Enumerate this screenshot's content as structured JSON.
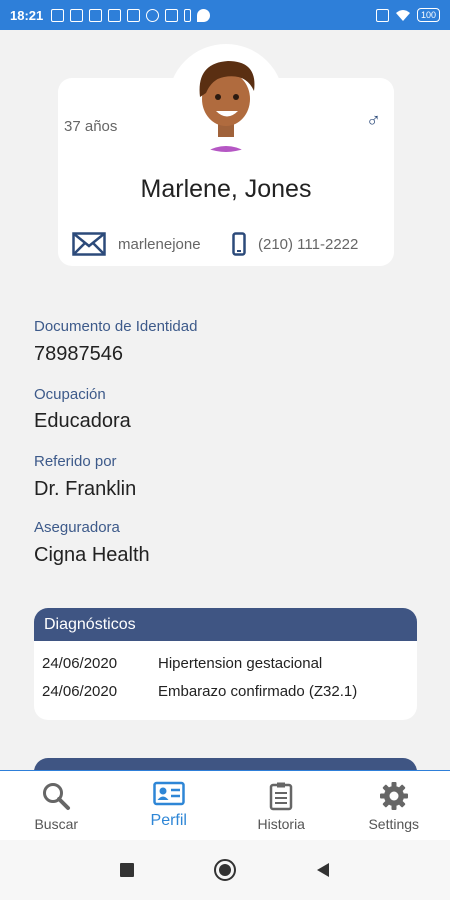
{
  "status_bar": {
    "time": "18:21",
    "battery": "100",
    "icons": [
      "upload-icon",
      "telegram-icon",
      "app-icon",
      "youtube-icon",
      "photo-icon",
      "check-icon",
      "instagram-icon",
      "pin-icon",
      "twitter-icon"
    ]
  },
  "profile": {
    "age": "37 años",
    "gender_symbol": "♂",
    "name": "Marlene, Jones",
    "email": "marlenejone",
    "phone": "(210) 111-2222"
  },
  "fields": [
    {
      "label": "Documento de Identidad",
      "value": "78987546"
    },
    {
      "label": "Ocupación",
      "value": "Educadora"
    },
    {
      "label": "Referido por",
      "value": "Dr. Franklin"
    },
    {
      "label": "Aseguradora",
      "value": "Cigna Health"
    }
  ],
  "diagnostics": {
    "title": "Diagnósticos",
    "rows": [
      {
        "date": "24/06/2020",
        "text": "Hipertension gestacional"
      },
      {
        "date": "24/06/2020",
        "text": "Embarazo confirmado (Z32.1)"
      }
    ]
  },
  "bottom_nav": [
    {
      "label": "Buscar",
      "icon": "search-icon",
      "active": false
    },
    {
      "label": "Perfil",
      "icon": "profile-card-icon",
      "active": true
    },
    {
      "label": "Historia",
      "icon": "clipboard-icon",
      "active": false
    },
    {
      "label": "Settings",
      "icon": "gear-icon",
      "active": false
    }
  ],
  "colors": {
    "primary": "#2e7fd9",
    "header": "#3f5583",
    "label": "#3d5a8a"
  }
}
